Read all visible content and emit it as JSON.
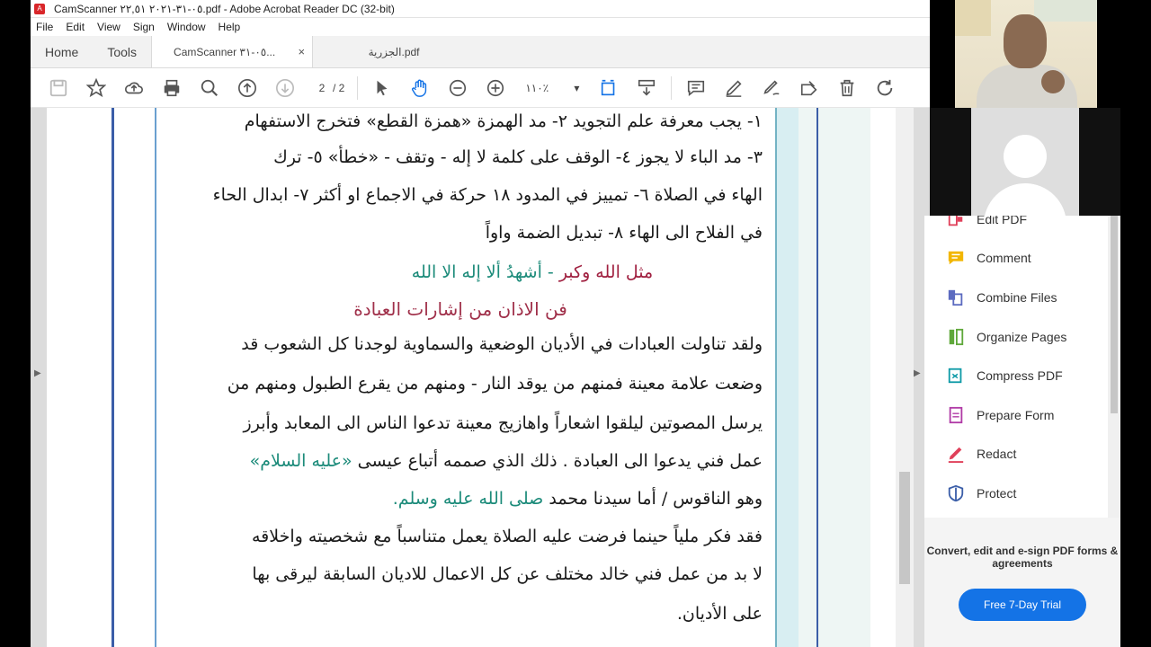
{
  "window": {
    "title": "CamScanner ٠٥-٣١-٢٠٢١ ٢٢,٥١.pdf - Adobe Acrobat Reader DC (32-bit)"
  },
  "menu": [
    "File",
    "Edit",
    "View",
    "Sign",
    "Window",
    "Help"
  ],
  "tabs": {
    "home": "Home",
    "tools": "Tools",
    "doc_active": "CamScanner ٠٥-٣١...",
    "doc_other": "الجزرية.pdf",
    "close": "×"
  },
  "toolbar": {
    "page_current": "2",
    "page_total": "/ 2",
    "zoom": "١١٠٪"
  },
  "document": {
    "line1": "١- يجب معرفة علم التجويد ٢- مد الهمزة «همزة القطع» فتخرج الاستفهام",
    "line2": "٣- مد الباء لا يجوز ٤- الوقف على كلمة لا إله - وتقف - «خطأ» ٥- ترك",
    "line3": "الهاء في الصلاة ٦- تمييز في المدود ١٨ حركة في الاجماع او أكثر ٧- ابدال الحاء",
    "line4": "في الفلاح الى الهاء ٨- تبديل الضمة واواً",
    "example_label": "مثل",
    "example_red": "الله وكبر",
    "example_rest": "- أشهدُ ألا إله الا الله",
    "heading": "فن الاذان من إشارات العبادة",
    "p1": "ولقد تناولت العبادات في الأديان الوضعية والسماوية لوجدنا كل الشعوب قد",
    "p2": "وضعت علامة معينة فمنهم من يوقد النار - ومنهم من يقرع الطبول ومنهم من",
    "p3": "يرسل المصوتين ليلقوا اشعاراً واهازيج معينة تدعوا الناس الى المعابد وأبرز",
    "p4_a": "عمل فني يدعوا الى العبادة . ذلك الذي صممه أتباع عيسى",
    "p4_b": "«عليه السلام»",
    "p5_a": "وهو الناقوس / أما سيدنا محمد",
    "p5_b": "صلى الله عليه وسلم.",
    "p6": "فقد فكر ملياً حينما فرضت عليه الصلاة يعمل متناسباً مع شخصيته واخلاقه",
    "p7": "لا بد من عمل فني خالد مختلف عن كل الاعمال للاديان السابقة ليرقى بها",
    "p8": "على الأديان."
  },
  "tools_pane": {
    "items": [
      {
        "label": "Edit PDF",
        "icon": "edit-pdf-icon",
        "color": "#e0405a"
      },
      {
        "label": "Comment",
        "icon": "comment-icon",
        "color": "#f2b600"
      },
      {
        "label": "Combine Files",
        "icon": "combine-files-icon",
        "color": "#5c6bc0"
      },
      {
        "label": "Organize Pages",
        "icon": "organize-pages-icon",
        "color": "#5fa83a"
      },
      {
        "label": "Compress PDF",
        "icon": "compress-pdf-icon",
        "color": "#0e9aa7"
      },
      {
        "label": "Prepare Form",
        "icon": "prepare-form-icon",
        "color": "#b03aa6"
      },
      {
        "label": "Redact",
        "icon": "redact-icon",
        "color": "#e0405a"
      },
      {
        "label": "Protect",
        "icon": "protect-icon",
        "color": "#3b5ea8"
      }
    ],
    "promo": "Convert, edit and e-sign PDF forms & agreements",
    "trial_button": "Free 7-Day Trial"
  },
  "colors": {
    "accent_blue": "#1473e6",
    "hand_tool_blue": "#1473e6"
  }
}
